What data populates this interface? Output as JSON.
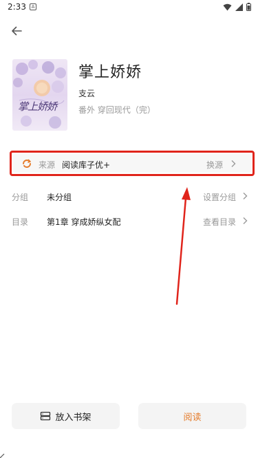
{
  "status": {
    "time": "2:33",
    "notif": "A"
  },
  "book": {
    "title": "掌上娇娇",
    "author": "支云",
    "meta": "番外 穿回现代（完）",
    "cover_text": "掌上娇娇"
  },
  "source": {
    "label": "来源",
    "value": "阅读库子优+",
    "action": "换源"
  },
  "group": {
    "label": "分组",
    "value": "未分组",
    "action": "设置分组"
  },
  "catalog": {
    "label": "目录",
    "value": "第1章 穿成娇纵女配",
    "action": "查看目录"
  },
  "buttons": {
    "shelf": "放入书架",
    "read": "阅读"
  },
  "colors": {
    "accent": "#e57c2c",
    "annotation": "#e0241b"
  }
}
